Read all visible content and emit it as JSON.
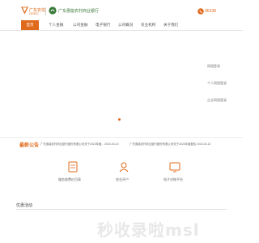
{
  "header": {
    "logo_brand_cn": "广东农信",
    "logo_brand_en": "GDRC",
    "bank_name": "广东惠能农村商业银行",
    "hotline": "96338"
  },
  "nav": {
    "items": [
      {
        "label": "首页",
        "active": true
      },
      {
        "label": "个人金融"
      },
      {
        "label": "公司金融"
      },
      {
        "label": "电子银行"
      },
      {
        "label": "公司概况"
      },
      {
        "label": "农业机构"
      },
      {
        "label": "关于我们"
      }
    ]
  },
  "banner": {
    "side_links": [
      "网银登录",
      "个人网银登录",
      "企业网银登录"
    ]
  },
  "notice": {
    "title": "最新公告",
    "items": [
      {
        "text": "广东惠能农村商业银行股份有限公司关于2023年度...",
        "date": "2023-04-10"
      },
      {
        "text": "广东惠能农村商业银行股份有限公司关于2023年度报告",
        "date": "2023-04-10"
      }
    ]
  },
  "services": [
    {
      "label": "服务收费价目表",
      "icon": "price-list-icon"
    },
    {
      "label": "农业开户",
      "icon": "account-icon"
    },
    {
      "label": "电子对账平台",
      "icon": "reconciliation-icon"
    }
  ],
  "promo": {
    "title": "优惠活动"
  },
  "watermark": "秒收录啦msl",
  "colors": {
    "accent": "#e06a1b",
    "green": "#3a7a3a"
  }
}
